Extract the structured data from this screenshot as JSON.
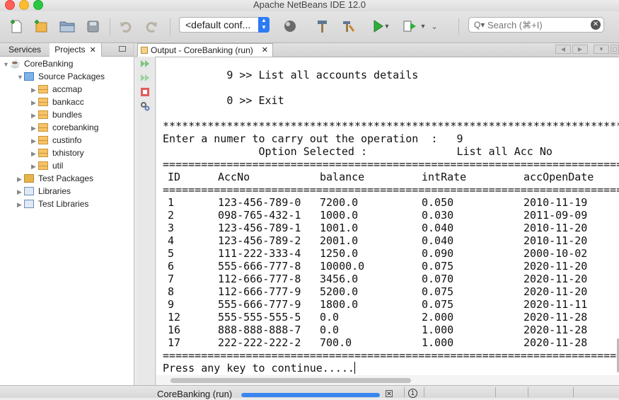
{
  "window": {
    "title": "Apache NetBeans IDE 12.0"
  },
  "toolbar": {
    "config_value": "<default conf...",
    "search_placeholder": "Search (⌘+I)",
    "search_glyph": "Q▾",
    "clear_glyph": "✕",
    "icons": [
      "new-file-icon",
      "new-project-icon",
      "open-project-icon",
      "save-all-icon",
      "undo-icon",
      "redo-icon",
      "config-dropdown",
      "clean-icon",
      "build-icon",
      "clean-build-icon",
      "run-icon",
      "debug-icon",
      "more-icon"
    ]
  },
  "left_panel": {
    "tabs": [
      {
        "label": "Services"
      },
      {
        "label": "Projects",
        "active": true,
        "close": "✕"
      }
    ],
    "tree": [
      {
        "label": "CoreBanking",
        "level": 0,
        "icon": "project",
        "expanded": true
      },
      {
        "label": "Source Packages",
        "level": 1,
        "icon": "source-packages",
        "expanded": true
      },
      {
        "label": "accmap",
        "level": 2,
        "icon": "package"
      },
      {
        "label": "bankacc",
        "level": 2,
        "icon": "package"
      },
      {
        "label": "bundles",
        "level": 2,
        "icon": "package"
      },
      {
        "label": "corebanking",
        "level": 2,
        "icon": "package"
      },
      {
        "label": "custinfo",
        "level": 2,
        "icon": "package"
      },
      {
        "label": "txhistory",
        "level": 2,
        "icon": "package"
      },
      {
        "label": "util",
        "level": 2,
        "icon": "package"
      },
      {
        "label": "Test Packages",
        "level": 1,
        "icon": "folder"
      },
      {
        "label": "Libraries",
        "level": 1,
        "icon": "library"
      },
      {
        "label": "Test Libraries",
        "level": 1,
        "icon": "library"
      }
    ]
  },
  "output": {
    "tab_label": "Output - CoreBanking (run)",
    "tab_close": "✕",
    "lines": {
      "menu9": "           9 >> List all accounts details",
      "menu0": "           0 >> Exit",
      "stars": " ************************************************************************",
      "prompt": " Enter a numer to carry out the operation  :   9",
      "selected": "                Option Selected :              List all Acc No",
      "rule1": " ========================================================================",
      "rule2": " ========================================================================",
      "rule3": " ========================================================================",
      "continue": " Press any key to continue....."
    },
    "columns": [
      "ID",
      "AccNo",
      "balance",
      "intRate",
      "accOpenDate"
    ],
    "rows": [
      [
        "1",
        "123-456-789-0",
        "7200.0",
        "0.050",
        "2010-11-19"
      ],
      [
        "2",
        "098-765-432-1",
        "1000.0",
        "0.030",
        "2011-09-09"
      ],
      [
        "3",
        "123-456-789-1",
        "1001.0",
        "0.040",
        "2010-11-20"
      ],
      [
        "4",
        "123-456-789-2",
        "2001.0",
        "0.040",
        "2010-11-20"
      ],
      [
        "5",
        "111-222-333-4",
        "1250.0",
        "0.090",
        "2000-10-02"
      ],
      [
        "6",
        "555-666-777-8",
        "10000.0",
        "0.075",
        "2020-11-20"
      ],
      [
        "7",
        "112-666-777-8",
        "3456.0",
        "0.070",
        "2020-11-20"
      ],
      [
        "8",
        "112-666-777-9",
        "5200.0",
        "0.075",
        "2020-11-20"
      ],
      [
        "9",
        "555-666-777-9",
        "1800.0",
        "0.075",
        "2020-11-11"
      ],
      [
        "12",
        "555-555-555-5",
        "0.0",
        "2.000",
        "2020-11-28"
      ],
      [
        "16",
        "888-888-888-7",
        "0.0",
        "1.000",
        "2020-11-28"
      ],
      [
        "17",
        "222-222-222-2",
        "700.0",
        "1.000",
        "2020-11-28"
      ]
    ]
  },
  "status_bar": {
    "task_label": "CoreBanking (run)",
    "progress": 0.98,
    "cancel": "✕",
    "notifications": "1"
  },
  "colors": {
    "accent": "#2d7bf4",
    "progress": "#3a86f0"
  }
}
